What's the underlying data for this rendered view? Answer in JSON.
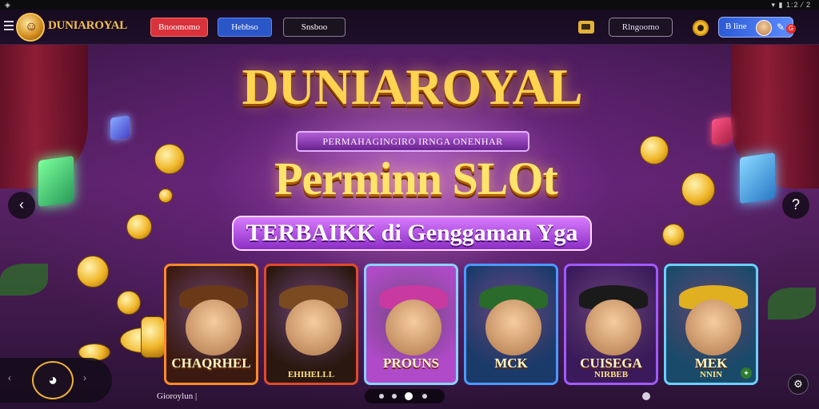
{
  "status_bar": {
    "left_icon": "shield-icon",
    "right_text": "▾ ▮ 1:2 ⁄ 2"
  },
  "nav": {
    "logo_glyph": "☺",
    "logo_text": "DUNIAROYAL",
    "button_red": "Bnoomomo",
    "button_blue": "Hebbso",
    "button_dark": "Snsboo",
    "wallet_icon": "wallet-icon",
    "search_label": "Rlngoomo",
    "profile_label": "B line",
    "edit_glyph": "✎",
    "notification_count": "G",
    "colors": {
      "red": "#d8323a",
      "blue": "#2b56c7",
      "gold": "#f3c14e"
    }
  },
  "hero": {
    "title": "DUNIAROYAL",
    "ribbon": "PERMAHAGINGIRO IRNGA ONENHAR",
    "headline": "Perminn SLOt",
    "tagline": "TERBAIKK di Genggaman Yga",
    "prev_glyph": "‹",
    "next_glyph": "?"
  },
  "games": [
    {
      "title": "CHAQRHEL",
      "subtitle": "",
      "bg": "#3a1a10",
      "border": "#ff8a2a",
      "hat": "#6a3a18"
    },
    {
      "title": "",
      "subtitle": "EHIHELLL",
      "bg": "#2a1810",
      "border": "#e04a2a",
      "hat": "#7a4a20"
    },
    {
      "title": "PROUNS",
      "subtitle": "",
      "bg": "#b04ac8",
      "border": "#8ad0ff",
      "hat": "#c83aa0"
    },
    {
      "title": "MCK",
      "subtitle": "",
      "bg": "#1a3a6a",
      "border": "#4a9aff",
      "hat": "#2a6a2a"
    },
    {
      "title": "CUISEGA",
      "subtitle": "NIRBEB",
      "bg": "#3a1a5a",
      "border": "#a05aff",
      "hat": "#1a1a1a"
    },
    {
      "title": "MEK",
      "subtitle": "NNIN",
      "bg": "#1a4a6a",
      "border": "#6ad0ff",
      "hat": "#e0b020"
    }
  ],
  "bottom": {
    "home_glyph": "◕",
    "left_arrow": "‹",
    "right_arrow": "›",
    "label": "Gioroylun |",
    "support_glyph": "⚙"
  }
}
